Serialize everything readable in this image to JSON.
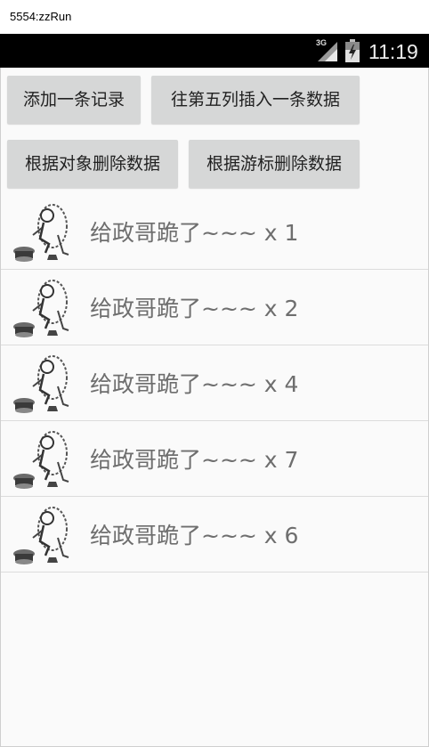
{
  "window": {
    "title": "5554:zzRun"
  },
  "status_bar": {
    "network": "3G",
    "time": "11:19",
    "signal_icon": "signal-icon",
    "battery_icon": "battery-icon"
  },
  "buttons": {
    "add_record": "添加一条记录",
    "insert_fifth": "往第五列插入一条数据",
    "delete_by_object": "根据对象删除数据",
    "delete_by_cursor": "根据游标删除数据"
  },
  "list": {
    "items": [
      {
        "label": "给政哥跪了~~~ x 1",
        "icon": "kneeling-figure-icon"
      },
      {
        "label": "给政哥跪了~~~ x 2",
        "icon": "kneeling-figure-icon"
      },
      {
        "label": "给政哥跪了~~~ x 4",
        "icon": "kneeling-figure-icon"
      },
      {
        "label": "给政哥跪了~~~ x 7",
        "icon": "kneeling-figure-icon"
      },
      {
        "label": "给政哥跪了~~~ x 6",
        "icon": "kneeling-figure-icon"
      }
    ]
  }
}
